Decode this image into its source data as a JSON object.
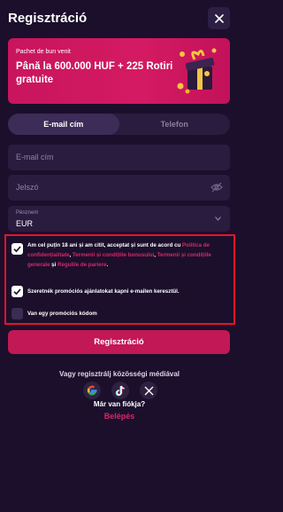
{
  "header": {
    "title": "Regisztráció"
  },
  "banner": {
    "subtitle": "Pachet de bun venit",
    "headline": "Până la 600.000 HUF + 225 Rotiri gratuite"
  },
  "tabs": [
    {
      "label": "E-mail cím",
      "active": true
    },
    {
      "label": "Telefon",
      "active": false
    }
  ],
  "form": {
    "email_placeholder": "E-mail cím",
    "password_placeholder": "Jelszó",
    "currency_label": "Pénznem",
    "currency_value": "EUR"
  },
  "consents": {
    "age_text": "Am cel puțin 18 ani și am citit, acceptat și sunt de acord cu ",
    "link_privacy": "Politica de confidențialitate",
    "sep1": ", ",
    "link_terms_bonus": "Termenii și condițiile bonusului",
    "sep2": ", ",
    "link_terms_general": "Termenii și condițiile generale",
    "sep3": " și ",
    "link_rules": "Regulile de pariere",
    "end": ".",
    "marketing_text": "Szeretnék promóciós ajánlatokat kapni e-mailen keresztül.",
    "promo_text": "Van egy promóciós kódom"
  },
  "actions": {
    "register": "Regisztráció",
    "social_caption": "Vagy regisztrálj közösségi médiával",
    "have_account": "Már van fiókja?",
    "login": "Belépés"
  },
  "colors": {
    "background": "#1b0f2c",
    "accent": "#c21855",
    "highlight_border": "#e6142a"
  },
  "icons": [
    "close-icon",
    "gift-box-icon",
    "eye-off-icon",
    "chevron-down-icon",
    "check-icon",
    "google-icon",
    "tiktok-icon",
    "x-icon"
  ]
}
